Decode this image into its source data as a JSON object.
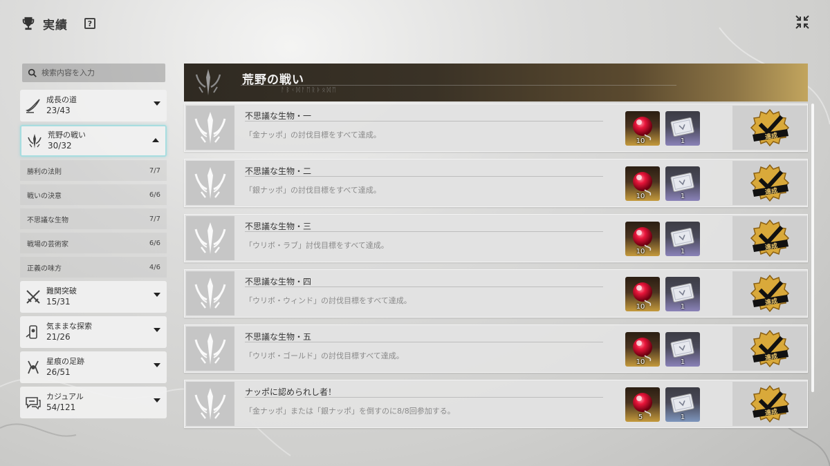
{
  "header": {
    "title": "実績",
    "help_label": "?"
  },
  "search": {
    "placeholder": "検索内容を入力"
  },
  "categories": [
    {
      "name": "成長の道",
      "count": "23/43",
      "icon": "quill-icon",
      "expanded": false
    },
    {
      "name": "荒野の戦い",
      "count": "30/32",
      "icon": "crest-icon",
      "expanded": true
    },
    {
      "name": "難関突破",
      "count": "15/31",
      "icon": "crossed-swords-icon",
      "expanded": false
    },
    {
      "name": "気ままな探索",
      "count": "21/26",
      "icon": "explore-icon",
      "expanded": false
    },
    {
      "name": "星痕の足跡",
      "count": "26/51",
      "icon": "star-mark-icon",
      "expanded": false
    },
    {
      "name": "カジュアル",
      "count": "54/121",
      "icon": "chat-icon",
      "expanded": false
    }
  ],
  "subcategories": [
    {
      "name": "勝利の法則",
      "count": "7/7"
    },
    {
      "name": "戦いの決意",
      "count": "6/6"
    },
    {
      "name": "不思議な生物",
      "count": "7/7"
    },
    {
      "name": "戦場の芸術家",
      "count": "6/6"
    },
    {
      "name": "正義の味方",
      "count": "4/6"
    }
  ],
  "banner": {
    "title": "荒野の戦い",
    "subtitle": "ᚨᛒᚲᛞᚨᛖᚱᚦᛟᛞᛖ"
  },
  "achievements": [
    {
      "name": "不思議な生物・一",
      "desc": "「金ナッポ」の討伐目標をすべて達成。",
      "reward1_qty": "10",
      "reward2_qty": "1",
      "reward2_style": "purple",
      "status": "達成"
    },
    {
      "name": "不思議な生物・二",
      "desc": "「銀ナッポ」の討伐目標をすべて達成。",
      "reward1_qty": "10",
      "reward2_qty": "1",
      "reward2_style": "purple",
      "status": "達成"
    },
    {
      "name": "不思議な生物・三",
      "desc": "「ウリボ・ラブ」討伐目標をすべて達成。",
      "reward1_qty": "10",
      "reward2_qty": "1",
      "reward2_style": "purple",
      "status": "達成"
    },
    {
      "name": "不思議な生物・四",
      "desc": "「ウリボ・ウィンド」の討伐目標をすべて達成。",
      "reward1_qty": "10",
      "reward2_qty": "1",
      "reward2_style": "purple",
      "status": "達成"
    },
    {
      "name": "不思議な生物・五",
      "desc": "「ウリボ・ゴールド」の討伐目標すべて達成。",
      "reward1_qty": "10",
      "reward2_qty": "1",
      "reward2_style": "purple",
      "status": "達成"
    },
    {
      "name": "ナッポに認められし者！",
      "desc": "「金ナッポ」または「銀ナッポ」を倒すのに8/8回参加する。",
      "reward1_qty": "5",
      "reward2_qty": "1",
      "reward2_style": "blue",
      "status": "達成"
    }
  ],
  "colors": {
    "accent_border": "#a7dde0",
    "banner_gold": "#c2a55e",
    "badge_gold": "#d9a93a"
  }
}
